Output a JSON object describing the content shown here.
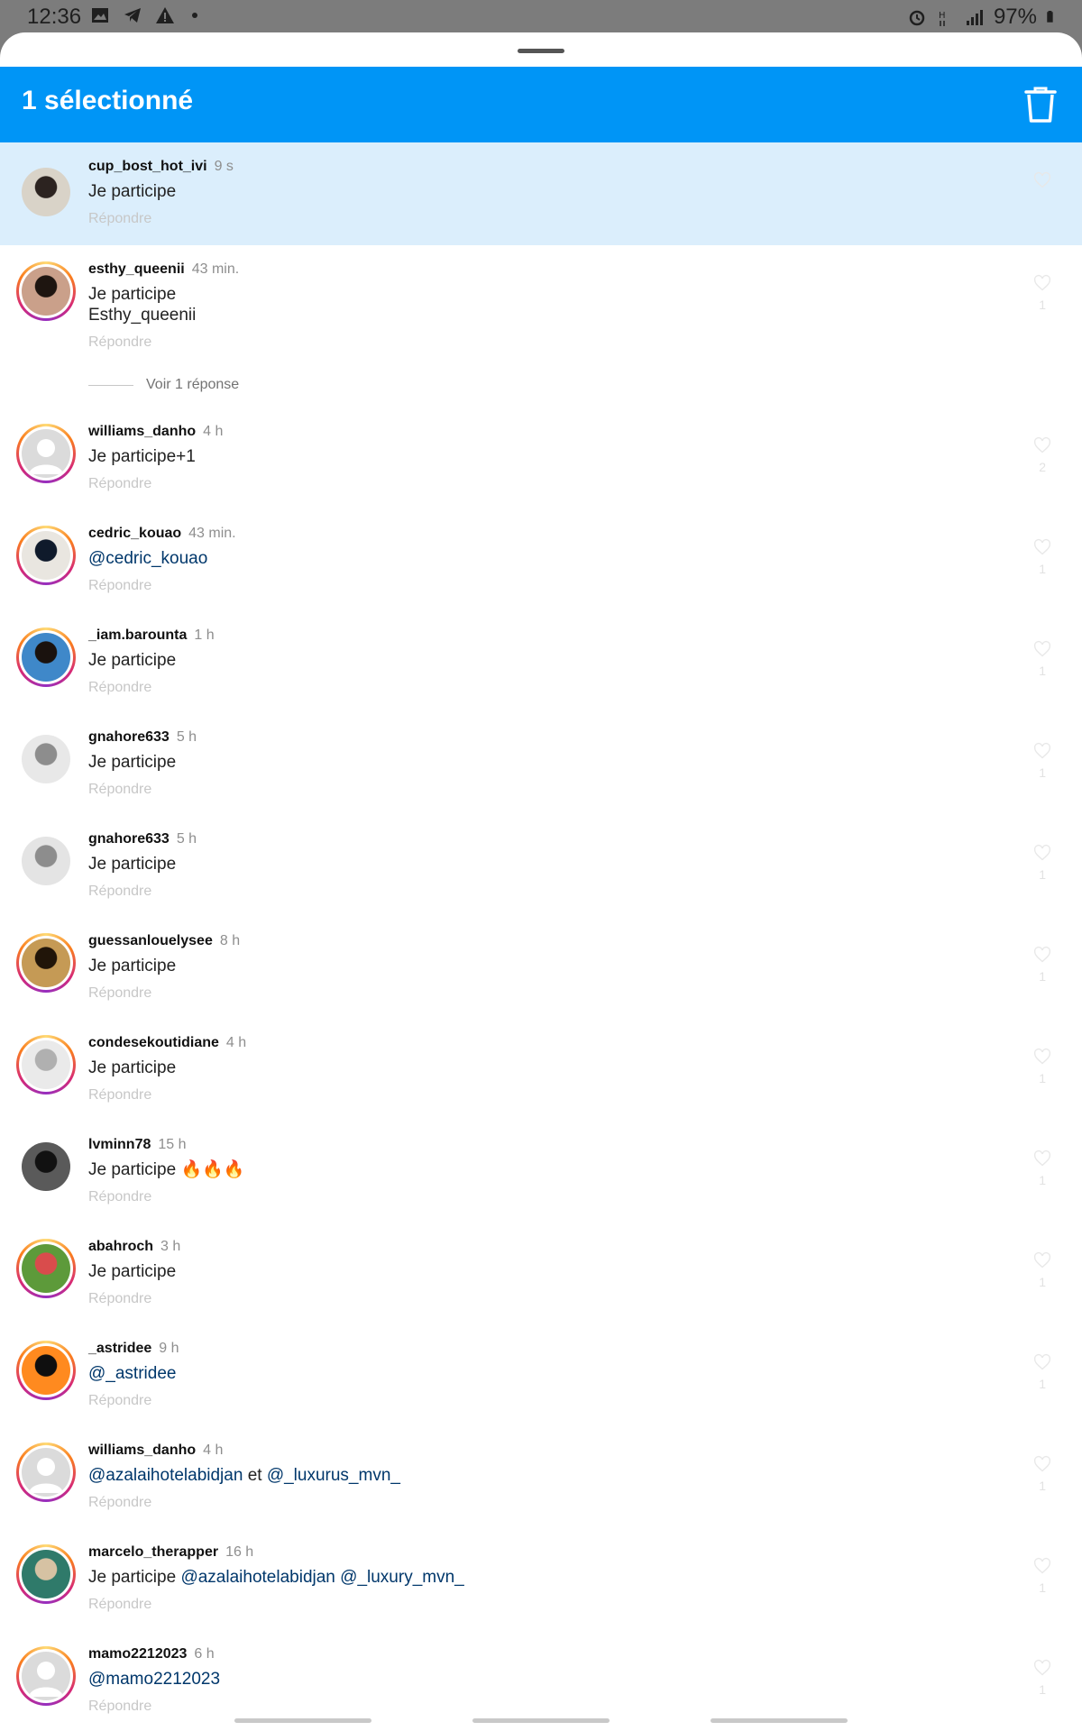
{
  "status_bar": {
    "time": "12:36",
    "battery_percent": "97%"
  },
  "header": {
    "title": "1 sélectionné",
    "bg_color": "#0095f6"
  },
  "reply_label": "Répondre",
  "view_replies_label": "Voir 1 réponse",
  "comments": [
    {
      "user": "cup_bost_hot_ivi",
      "time": "9 s",
      "lines": [
        "Je participe"
      ],
      "selected": true,
      "like_count": ""
    },
    {
      "user": "esthy_queenii",
      "time": "43 min.",
      "lines": [
        "Je participe",
        "Esthy_queenii"
      ],
      "like_count": "1"
    },
    {
      "user": "williams_danho",
      "time": "4 h",
      "lines": [
        "Je participe+1"
      ],
      "like_count": "2"
    },
    {
      "user": "cedric_kouao",
      "time": "43 min.",
      "mention": "@cedric_kouao",
      "like_count": "1"
    },
    {
      "user": "_iam.barounta",
      "time": "1 h",
      "lines": [
        "Je participe"
      ],
      "like_count": "1"
    },
    {
      "user": "gnahore633",
      "time": "5 h",
      "lines": [
        "Je participe"
      ],
      "like_count": "1"
    },
    {
      "user": "gnahore633",
      "time": "5 h",
      "lines": [
        "Je participe"
      ],
      "like_count": "1"
    },
    {
      "user": "guessanlouelysee",
      "time": "8 h",
      "lines": [
        "Je participe"
      ],
      "like_count": "1"
    },
    {
      "user": "condesekoutidiane",
      "time": "4 h",
      "lines": [
        "Je participe"
      ],
      "like_count": "1"
    },
    {
      "user": "lvminn78",
      "time": "15 h",
      "lines": [
        "Je participe 🔥🔥🔥"
      ],
      "like_count": "1"
    },
    {
      "user": "abahroch",
      "time": "3 h",
      "lines": [
        "Je participe"
      ],
      "like_count": "1"
    },
    {
      "user": "_astridee",
      "time": "9 h",
      "mention": "@_astridee",
      "like_count": "1"
    },
    {
      "user": "williams_danho",
      "time": "4 h",
      "mention_a": "@azalaihotelabidjan",
      "connector": " et ",
      "mention_b": "@_luxurus_mvn_",
      "like_count": "1"
    },
    {
      "user": "marcelo_therapper",
      "time": "16 h",
      "prefix": "Je participe ",
      "mention_a": "@azalaihotelabidjan",
      "connector": " ",
      "mention_b": "@_luxury_mvn_",
      "like_count": "1"
    },
    {
      "user": "mamo2212023",
      "time": "6 h",
      "mention": "@mamo2212023",
      "like_count": "1"
    }
  ]
}
